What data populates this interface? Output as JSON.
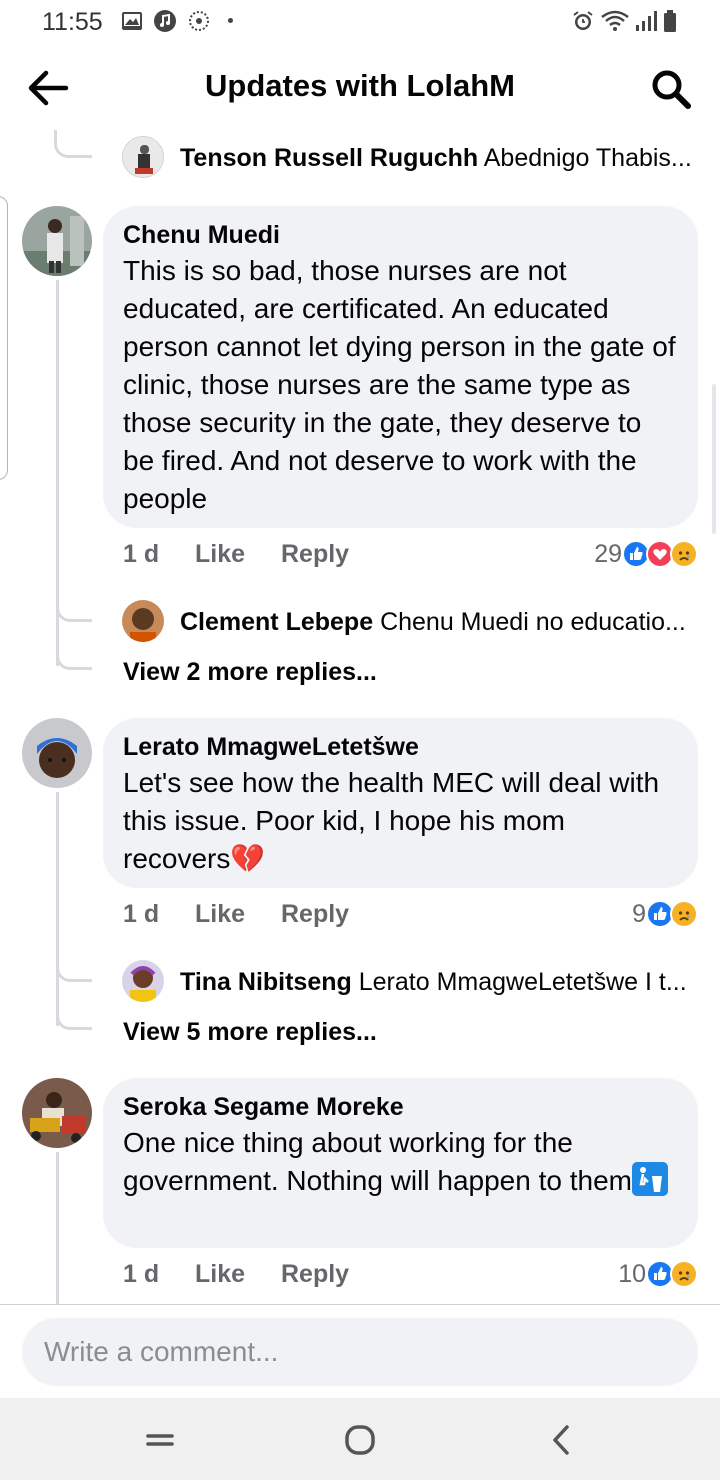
{
  "status_bar": {
    "time": "11:55",
    "left_icons": [
      "image-icon",
      "music-icon",
      "flower-icon",
      "dot-icon"
    ],
    "right_icons": [
      "alarm-icon",
      "wifi-icon",
      "signal-icon",
      "battery-icon"
    ]
  },
  "header": {
    "title": "Updates with LolahM",
    "back_icon": "arrow-left-icon",
    "search_icon": "search-icon"
  },
  "top_reply": {
    "author": "Tenson Russell Ruguchh",
    "preview": "Abednigo Thabis..."
  },
  "comments": [
    {
      "author": "Chenu Muedi",
      "text": "This is so bad, those nurses are not educated, are certificated. An educated person cannot let dying person in the gate of clinic, those nurses are the same type as those security in the gate, they deserve to be fired. And not deserve to work with the people",
      "time": "1 d",
      "like": "Like",
      "reply": "Reply",
      "reaction_count": "29",
      "reactions": [
        "like-reaction-icon",
        "love-reaction-icon",
        "sad-reaction-icon"
      ],
      "reply_preview": {
        "author": "Clement Lebepe",
        "text": "Chenu Muedi no educatio..."
      },
      "view_more": "View 2 more replies..."
    },
    {
      "author": "Lerato MmagweLetetšwe",
      "text": "Let's see how the health MEC will deal with this issue. Poor kid, I hope his mom recovers",
      "emoji": "💔",
      "time": "1 d",
      "like": "Like",
      "reply": "Reply",
      "reaction_count": "9",
      "reactions": [
        "like-reaction-icon",
        "sad-reaction-icon"
      ],
      "reply_preview": {
        "author": "Tina Nibitseng",
        "text": "Lerato MmagweLetetšwe I t..."
      },
      "view_more": "View 5 more replies..."
    },
    {
      "author": "Seroka Segame Moreke",
      "text": "One nice thing about working for the government. Nothing will happen to them",
      "emoji": "🚮",
      "time": "1 d",
      "like": "Like",
      "reply": "Reply",
      "reaction_count": "10",
      "reactions": [
        "like-reaction-icon",
        "sad-reaction-icon"
      ]
    }
  ],
  "composer": {
    "placeholder": "Write a comment..."
  },
  "nav": {
    "icons": [
      "recents-icon",
      "home-icon",
      "back-icon"
    ]
  },
  "colors": {
    "like_blue": "#1877f2",
    "love_red": "#f33e58",
    "sad_yellow": "#f7b125",
    "bubble": "#f0f2f5",
    "secondary_text": "#65676b"
  }
}
